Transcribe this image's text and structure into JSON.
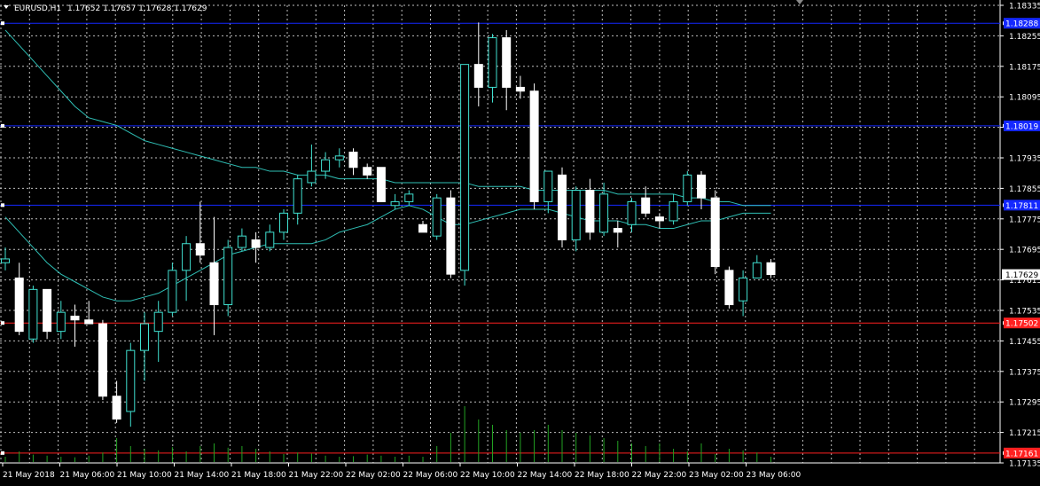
{
  "header": {
    "symbol": "EURUSD,H1",
    "ohlc": "1.17652 1.17657 1.17628 1.17629"
  },
  "colors": {
    "background": "#000000",
    "grid": "#bfbfbf",
    "bull_candle": "#000000",
    "bull_outline": "#40e0d0",
    "bear_candle": "#ffffff",
    "bear_outline": "#ffffff",
    "ma": "#2fbfb5",
    "hline_blue": "#1428ff",
    "hline_red": "#ff2020",
    "volume": "#22a222",
    "axis_text": "#ffffff"
  },
  "chart_data": {
    "type": "candlestick",
    "title": "EURUSD,H1",
    "ylim": [
      1.17135,
      1.18335
    ],
    "y_ticks": [
      "1.18335",
      "1.18255",
      "1.18175",
      "1.18095",
      "1.18015",
      "1.17935",
      "1.17855",
      "1.17775",
      "1.17695",
      "1.17615",
      "1.17535",
      "1.17455",
      "1.17375",
      "1.17295",
      "1.17215",
      "1.17135"
    ],
    "current_price": "1.17629",
    "horizontal_levels": [
      {
        "price": 1.18288,
        "label": "1.18288",
        "color": "blue"
      },
      {
        "price": 1.18019,
        "label": "1.18019",
        "color": "blue"
      },
      {
        "price": 1.17811,
        "label": "1.17811",
        "color": "blue"
      },
      {
        "price": 1.17502,
        "label": "1.17502",
        "color": "red"
      },
      {
        "price": 1.17161,
        "label": "1.17161",
        "color": "red"
      }
    ],
    "x_labels": [
      "21 May 2018",
      "21 May 06:00",
      "21 May 10:00",
      "21 May 14:00",
      "21 May 18:00",
      "21 May 22:00",
      "22 May 02:00",
      "22 May 06:00",
      "22 May 10:00",
      "22 May 14:00",
      "22 May 18:00",
      "22 May 22:00",
      "23 May 02:00",
      "23 May 06:00"
    ],
    "candles": [
      {
        "o": 1.1766,
        "h": 1.177,
        "l": 1.1764,
        "c": 1.1767
      },
      {
        "o": 1.1762,
        "h": 1.1766,
        "l": 1.1747,
        "c": 1.1748
      },
      {
        "o": 1.1746,
        "h": 1.176,
        "l": 1.1745,
        "c": 1.1759
      },
      {
        "o": 1.1759,
        "h": 1.1759,
        "l": 1.1746,
        "c": 1.1748
      },
      {
        "o": 1.1748,
        "h": 1.1756,
        "l": 1.1746,
        "c": 1.1753
      },
      {
        "o": 1.1752,
        "h": 1.1755,
        "l": 1.1744,
        "c": 1.1751
      },
      {
        "o": 1.1751,
        "h": 1.1756,
        "l": 1.175,
        "c": 1.175
      },
      {
        "o": 1.175,
        "h": 1.1751,
        "l": 1.173,
        "c": 1.1731
      },
      {
        "o": 1.1731,
        "h": 1.1735,
        "l": 1.1724,
        "c": 1.1725
      },
      {
        "o": 1.1727,
        "h": 1.1745,
        "l": 1.1723,
        "c": 1.1743
      },
      {
        "o": 1.1743,
        "h": 1.1753,
        "l": 1.1735,
        "c": 1.175
      },
      {
        "o": 1.1748,
        "h": 1.1756,
        "l": 1.174,
        "c": 1.1753
      },
      {
        "o": 1.1753,
        "h": 1.1766,
        "l": 1.1752,
        "c": 1.1764
      },
      {
        "o": 1.1764,
        "h": 1.1773,
        "l": 1.1756,
        "c": 1.1771
      },
      {
        "o": 1.1771,
        "h": 1.1782,
        "l": 1.1766,
        "c": 1.1768
      },
      {
        "o": 1.1766,
        "h": 1.1778,
        "l": 1.1747,
        "c": 1.1755
      },
      {
        "o": 1.1755,
        "h": 1.1772,
        "l": 1.1752,
        "c": 1.177
      },
      {
        "o": 1.177,
        "h": 1.1775,
        "l": 1.1769,
        "c": 1.1773
      },
      {
        "o": 1.1772,
        "h": 1.1774,
        "l": 1.1766,
        "c": 1.177
      },
      {
        "o": 1.177,
        "h": 1.1776,
        "l": 1.1769,
        "c": 1.1774
      },
      {
        "o": 1.1774,
        "h": 1.178,
        "l": 1.1772,
        "c": 1.1779
      },
      {
        "o": 1.1779,
        "h": 1.1789,
        "l": 1.1776,
        "c": 1.1788
      },
      {
        "o": 1.1787,
        "h": 1.1797,
        "l": 1.1786,
        "c": 1.179
      },
      {
        "o": 1.179,
        "h": 1.1795,
        "l": 1.1788,
        "c": 1.1793
      },
      {
        "o": 1.1793,
        "h": 1.1796,
        "l": 1.1791,
        "c": 1.1794
      },
      {
        "o": 1.1795,
        "h": 1.1796,
        "l": 1.1789,
        "c": 1.1791
      },
      {
        "o": 1.1791,
        "h": 1.1792,
        "l": 1.1788,
        "c": 1.1789
      },
      {
        "o": 1.1791,
        "h": 1.1791,
        "l": 1.1783,
        "c": 1.1782
      },
      {
        "o": 1.1781,
        "h": 1.1784,
        "l": 1.178,
        "c": 1.1782
      },
      {
        "o": 1.1782,
        "h": 1.1785,
        "l": 1.1781,
        "c": 1.1784
      },
      {
        "o": 1.1776,
        "h": 1.1777,
        "l": 1.1774,
        "c": 1.1774
      },
      {
        "o": 1.1773,
        "h": 1.1784,
        "l": 1.1772,
        "c": 1.1783
      },
      {
        "o": 1.1783,
        "h": 1.1785,
        "l": 1.1762,
        "c": 1.1763
      },
      {
        "o": 1.1764,
        "h": 1.1818,
        "l": 1.176,
        "c": 1.1818
      },
      {
        "o": 1.1818,
        "h": 1.1829,
        "l": 1.1807,
        "c": 1.1812
      },
      {
        "o": 1.1812,
        "h": 1.1826,
        "l": 1.1808,
        "c": 1.1825
      },
      {
        "o": 1.1825,
        "h": 1.1827,
        "l": 1.1806,
        "c": 1.1812
      },
      {
        "o": 1.1812,
        "h": 1.1815,
        "l": 1.1809,
        "c": 1.1811
      },
      {
        "o": 1.1811,
        "h": 1.1813,
        "l": 1.178,
        "c": 1.1782
      },
      {
        "o": 1.1782,
        "h": 1.179,
        "l": 1.1779,
        "c": 1.179
      },
      {
        "o": 1.1789,
        "h": 1.1791,
        "l": 1.177,
        "c": 1.1772
      },
      {
        "o": 1.1772,
        "h": 1.1786,
        "l": 1.1769,
        "c": 1.1785
      },
      {
        "o": 1.1785,
        "h": 1.1788,
        "l": 1.1772,
        "c": 1.1774
      },
      {
        "o": 1.1774,
        "h": 1.1787,
        "l": 1.1773,
        "c": 1.1784
      },
      {
        "o": 1.1775,
        "h": 1.1777,
        "l": 1.177,
        "c": 1.1774
      },
      {
        "o": 1.1776,
        "h": 1.1783,
        "l": 1.1774,
        "c": 1.1782
      },
      {
        "o": 1.1783,
        "h": 1.1786,
        "l": 1.1778,
        "c": 1.1779
      },
      {
        "o": 1.1778,
        "h": 1.1779,
        "l": 1.1775,
        "c": 1.1777
      },
      {
        "o": 1.1777,
        "h": 1.1784,
        "l": 1.1776,
        "c": 1.1782
      },
      {
        "o": 1.1782,
        "h": 1.179,
        "l": 1.1781,
        "c": 1.1789
      },
      {
        "o": 1.1789,
        "h": 1.179,
        "l": 1.178,
        "c": 1.1783
      },
      {
        "o": 1.1783,
        "h": 1.1785,
        "l": 1.1763,
        "c": 1.1765
      },
      {
        "o": 1.1764,
        "h": 1.1765,
        "l": 1.1754,
        "c": 1.1755
      },
      {
        "o": 1.1756,
        "h": 1.1764,
        "l": 1.1752,
        "c": 1.1762
      },
      {
        "o": 1.1762,
        "h": 1.1768,
        "l": 1.1762,
        "c": 1.1766
      },
      {
        "o": 1.1766,
        "h": 1.1767,
        "l": 1.1762,
        "c": 1.17629
      }
    ],
    "ma_fast": [
      1.1778,
      1.1774,
      1.177,
      1.1766,
      1.1763,
      1.1761,
      1.1759,
      1.1757,
      1.1756,
      1.1756,
      1.1757,
      1.1758,
      1.176,
      1.1762,
      1.1764,
      1.1766,
      1.1768,
      1.1769,
      1.177,
      1.1771,
      1.1771,
      1.1771,
      1.1771,
      1.1772,
      1.1774,
      1.1775,
      1.1776,
      1.1778,
      1.178,
      1.1781,
      1.178,
      1.1778,
      1.1776,
      1.1776,
      1.1777,
      1.1778,
      1.1779,
      1.178,
      1.178,
      1.178,
      1.1779,
      1.1778,
      1.1777,
      1.1777,
      1.1777,
      1.1776,
      1.1776,
      1.1775,
      1.1775,
      1.1776,
      1.1777,
      1.1777,
      1.1778,
      1.1779,
      1.1779,
      1.1779
    ],
    "ma_slow": [
      1.1827,
      1.1823,
      1.1819,
      1.1815,
      1.1811,
      1.1807,
      1.1804,
      1.1803,
      1.1802,
      1.18,
      1.1798,
      1.1797,
      1.1796,
      1.1795,
      1.1794,
      1.1793,
      1.1792,
      1.1791,
      1.1791,
      1.179,
      1.179,
      1.1789,
      1.1789,
      1.1789,
      1.1788,
      1.1788,
      1.1788,
      1.1788,
      1.1787,
      1.1787,
      1.1787,
      1.1787,
      1.1787,
      1.1787,
      1.1786,
      1.1786,
      1.1786,
      1.1786,
      1.1785,
      1.1785,
      1.1785,
      1.1785,
      1.1785,
      1.1785,
      1.1784,
      1.1784,
      1.1784,
      1.1784,
      1.1784,
      1.1783,
      1.1783,
      1.1782,
      1.1782,
      1.1781,
      1.1781,
      1.1781
    ],
    "volumes": [
      10,
      20,
      14,
      12,
      10,
      9,
      12,
      18,
      45,
      30,
      25,
      22,
      28,
      20,
      30,
      35,
      27,
      30,
      25,
      20,
      15,
      18,
      16,
      12,
      10,
      11,
      14,
      12,
      10,
      12,
      10,
      30,
      55,
      105,
      80,
      70,
      60,
      55,
      60,
      70,
      60,
      55,
      50,
      45,
      40,
      35,
      30,
      35,
      25,
      20,
      35,
      15,
      25,
      22,
      18,
      10
    ]
  }
}
